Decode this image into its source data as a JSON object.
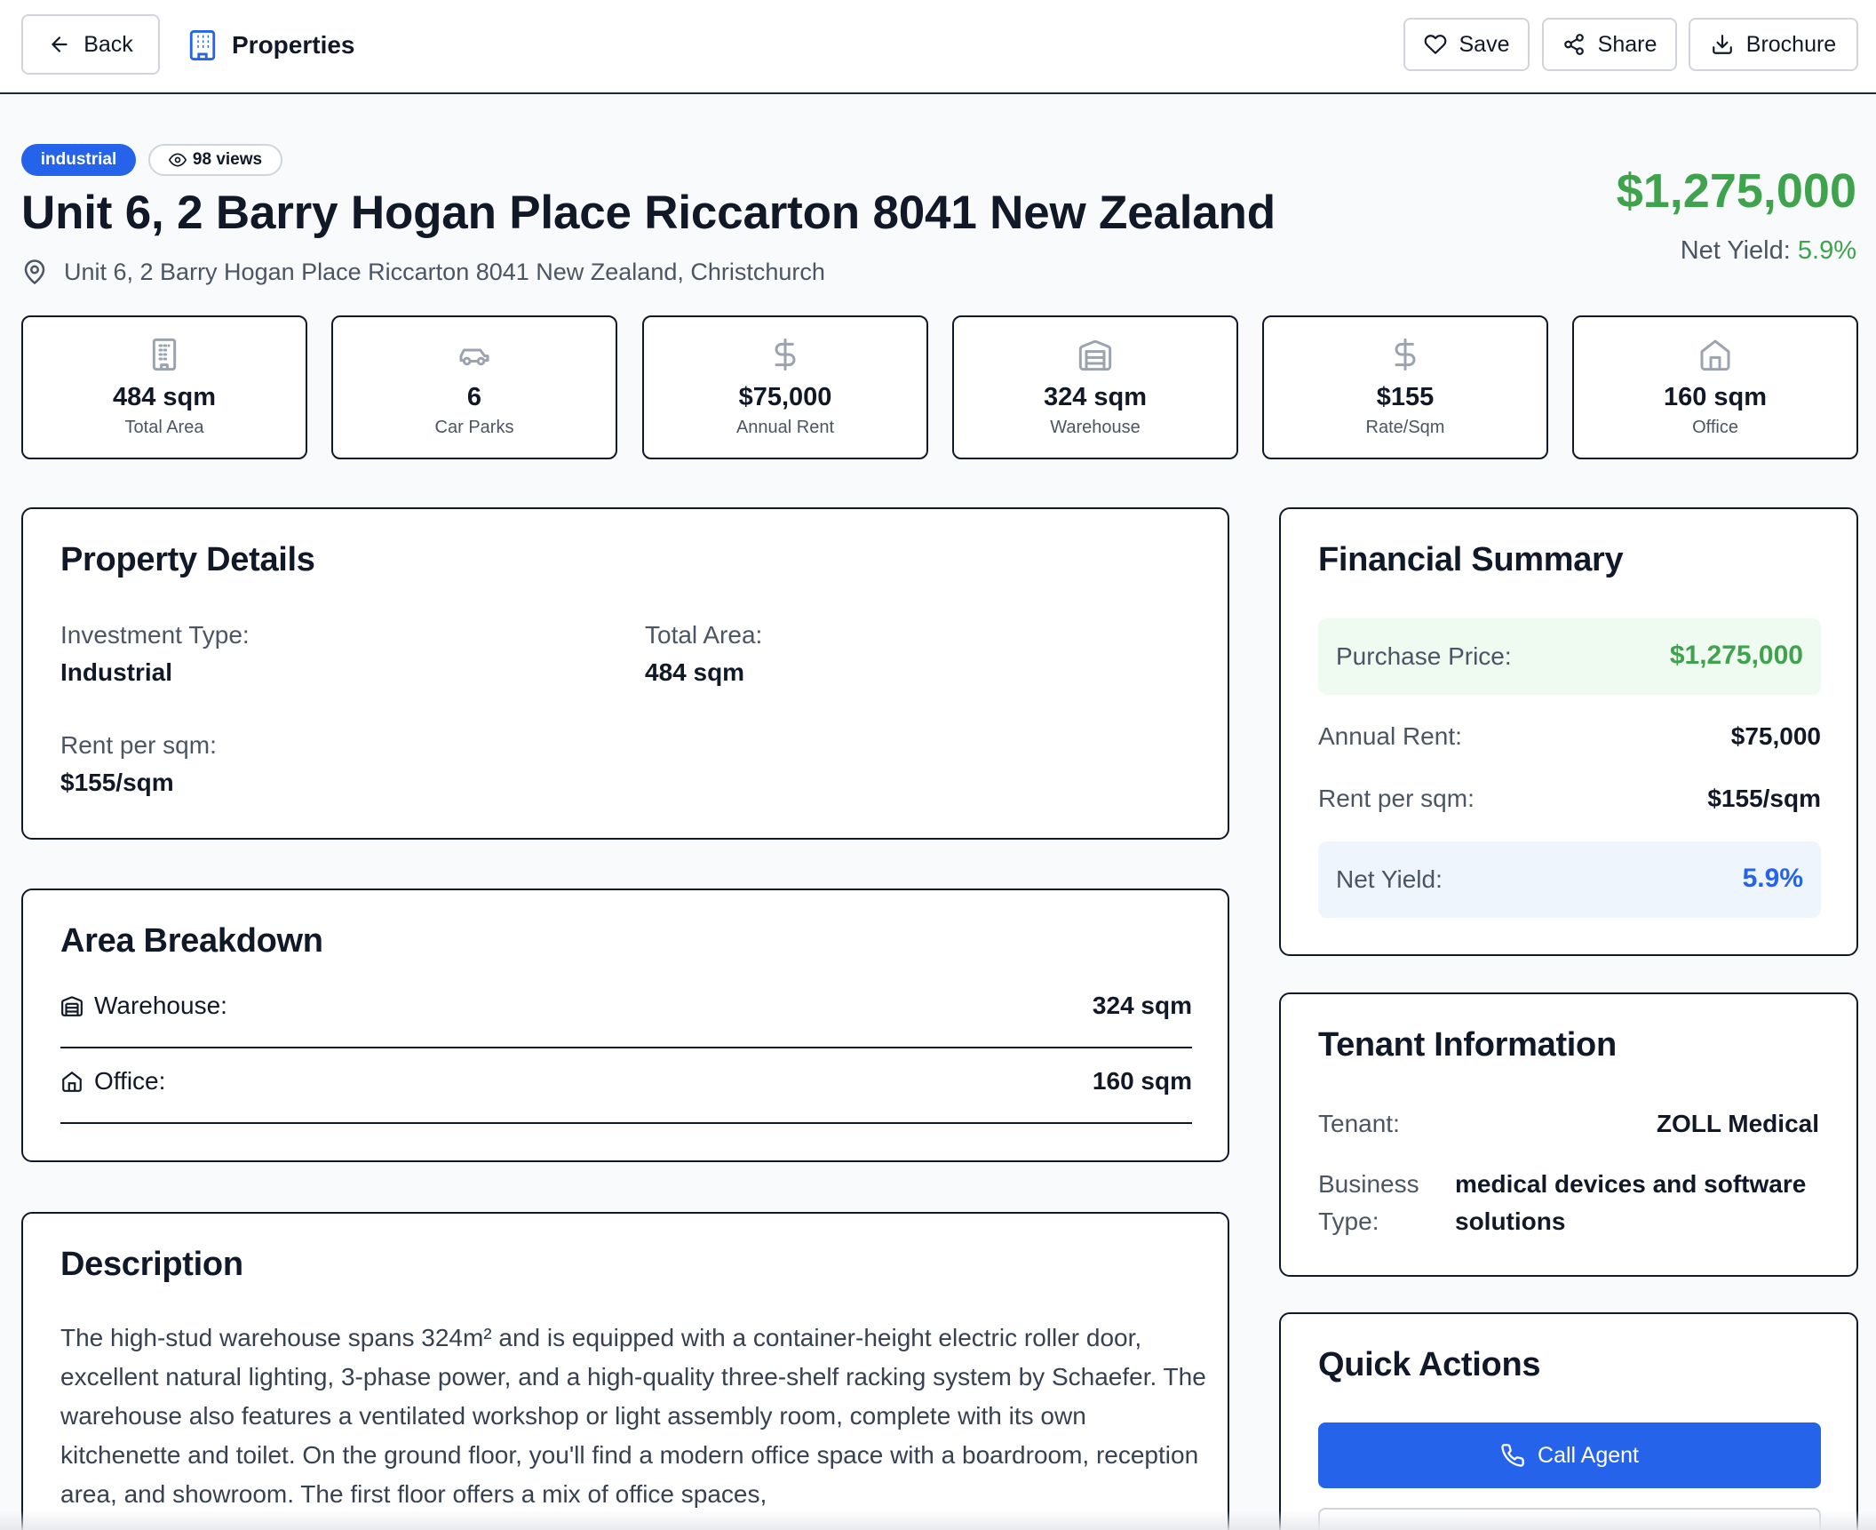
{
  "header": {
    "back_label": "Back",
    "brand_label": "Properties",
    "save_label": "Save",
    "share_label": "Share",
    "brochure_label": "Brochure"
  },
  "listing": {
    "type_badge": "industrial",
    "views": "98 views",
    "title": "Unit 6, 2 Barry Hogan Place Riccarton 8041 New Zealand",
    "address": "Unit 6, 2 Barry Hogan Place Riccarton 8041 New Zealand, Christchurch",
    "price": "$1,275,000",
    "net_yield_label": "Net Yield:",
    "net_yield_value": "5.9%"
  },
  "stats": [
    {
      "value": "484 sqm",
      "label": "Total Area",
      "icon": "building-icon"
    },
    {
      "value": "6",
      "label": "Car Parks",
      "icon": "car-icon"
    },
    {
      "value": "$75,000",
      "label": "Annual Rent",
      "icon": "dollar-icon"
    },
    {
      "value": "324 sqm",
      "label": "Warehouse",
      "icon": "warehouse-icon"
    },
    {
      "value": "$155",
      "label": "Rate/Sqm",
      "icon": "dollar-icon"
    },
    {
      "value": "160 sqm",
      "label": "Office",
      "icon": "home-icon"
    }
  ],
  "details": {
    "title": "Property Details",
    "investment_type_label": "Investment Type:",
    "investment_type_value": "Industrial",
    "total_area_label": "Total Area:",
    "total_area_value": "484 sqm",
    "rent_label": "Rent per sqm:",
    "rent_value": "$155/sqm"
  },
  "area": {
    "title": "Area Breakdown",
    "rows": [
      {
        "label": "Warehouse:",
        "value": "324 sqm",
        "icon": "warehouse-icon"
      },
      {
        "label": "Office:",
        "value": "160 sqm",
        "icon": "home-icon"
      }
    ]
  },
  "description": {
    "title": "Description",
    "text": "The high-stud warehouse spans 324m² and is equipped with a container-height electric roller door, excellent natural lighting, 3-phase power, and a high-quality three-shelf racking system by Schaefer. The warehouse also features a ventilated workshop or light assembly room, complete with its own kitchenette and toilet. On the ground floor, you'll find a modern office space with a boardroom, reception area, and showroom. The first floor offers a mix of office spaces,"
  },
  "financial": {
    "title": "Financial Summary",
    "purchase_label": "Purchase Price:",
    "purchase_value": "$1,275,000",
    "rent_label": "Annual Rent:",
    "rent_value": "$75,000",
    "rate_label": "Rent per sqm:",
    "rate_value": "$155/sqm",
    "yield_label": "Net Yield:",
    "yield_value": "5.9%"
  },
  "tenant": {
    "title": "Tenant Information",
    "tenant_label": "Tenant:",
    "tenant_value": "ZOLL Medical",
    "business_label_1": "Business",
    "business_label_2": "Type:",
    "business_value_1": "medical devices and software",
    "business_value_2": "solutions"
  },
  "actions": {
    "title": "Quick Actions",
    "call_label": "Call Agent"
  },
  "colors": {
    "accent": "#2563eb",
    "price_green": "#3fa34d",
    "border": "#111827"
  }
}
